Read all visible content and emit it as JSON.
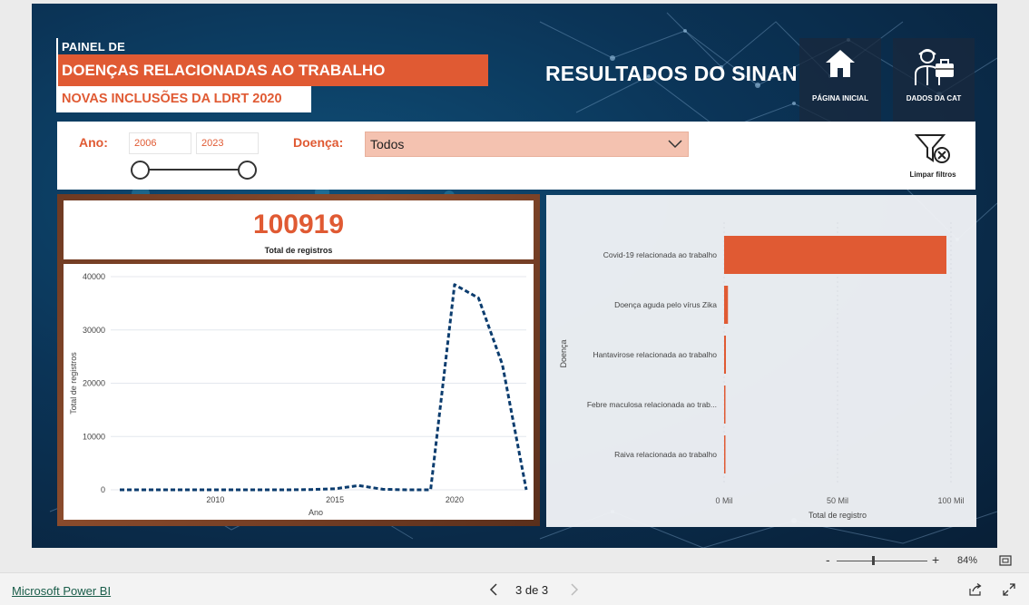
{
  "header": {
    "painel_label": "PAINEL DE",
    "title": "DOENÇAS RELACIONADAS AO TRABALHO",
    "subtitle": "NOVAS INCLUSÕES DA LDRT 2020",
    "sinan_title": "RESULTADOS DO SINAN",
    "nav": [
      {
        "label": "PÁGINA INICIAL",
        "icon": "home-icon"
      },
      {
        "label": "DADOS DA CAT",
        "icon": "worker-briefcase-icon"
      }
    ]
  },
  "filters": {
    "ano_label": "Ano:",
    "ano_from": "2006",
    "ano_to": "2023",
    "doenca_label": "Doença:",
    "doenca_value": "Todos",
    "clear_label": "Limpar filtros"
  },
  "kpi": {
    "value": "100919",
    "label": "Total de registros"
  },
  "chart_data": [
    {
      "type": "line",
      "x": [
        2006,
        2007,
        2008,
        2009,
        2010,
        2011,
        2012,
        2013,
        2014,
        2015,
        2016,
        2017,
        2018,
        2019,
        2020,
        2021,
        2022,
        2023
      ],
      "series": [
        {
          "values": [
            0,
            0,
            0,
            0,
            0,
            0,
            0,
            0,
            50,
            200,
            800,
            100,
            0,
            0,
            38500,
            36000,
            23500,
            0
          ]
        }
      ],
      "xlabel": "Ano",
      "ylabel": "Total de registros",
      "xticks": [
        2010,
        2015,
        2020
      ],
      "yticks": [
        0,
        10000,
        20000,
        30000,
        40000
      ],
      "xlim": [
        2006,
        2023
      ],
      "ylim": [
        0,
        40000
      ],
      "grid": true,
      "color": "#0b3c6e",
      "line_style": "dashed"
    },
    {
      "type": "bar",
      "orientation": "horizontal",
      "categories": [
        "Covid-19 relacionada ao trabalho",
        "Doença aguda pelo vírus Zika",
        "Hantavirose relacionada ao trabalho",
        "Febre maculosa relacionada ao trab...",
        "Raiva relacionada ao trabalho"
      ],
      "values": [
        98000,
        1700,
        800,
        400,
        50
      ],
      "xlabel": "Total de registro",
      "ylabel": "Doença",
      "xticks": [
        "0 Mil",
        "50 Mil",
        "100 Mil"
      ],
      "xtick_values": [
        0,
        50000,
        100000
      ],
      "xlim": [
        0,
        100000
      ],
      "color": "#e05a33"
    }
  ],
  "footer": {
    "zoom_minus": "-",
    "zoom_plus": "+",
    "zoom_pct": "84%",
    "app_name": "Microsoft Power BI",
    "page_indicator": "3 de 3"
  }
}
